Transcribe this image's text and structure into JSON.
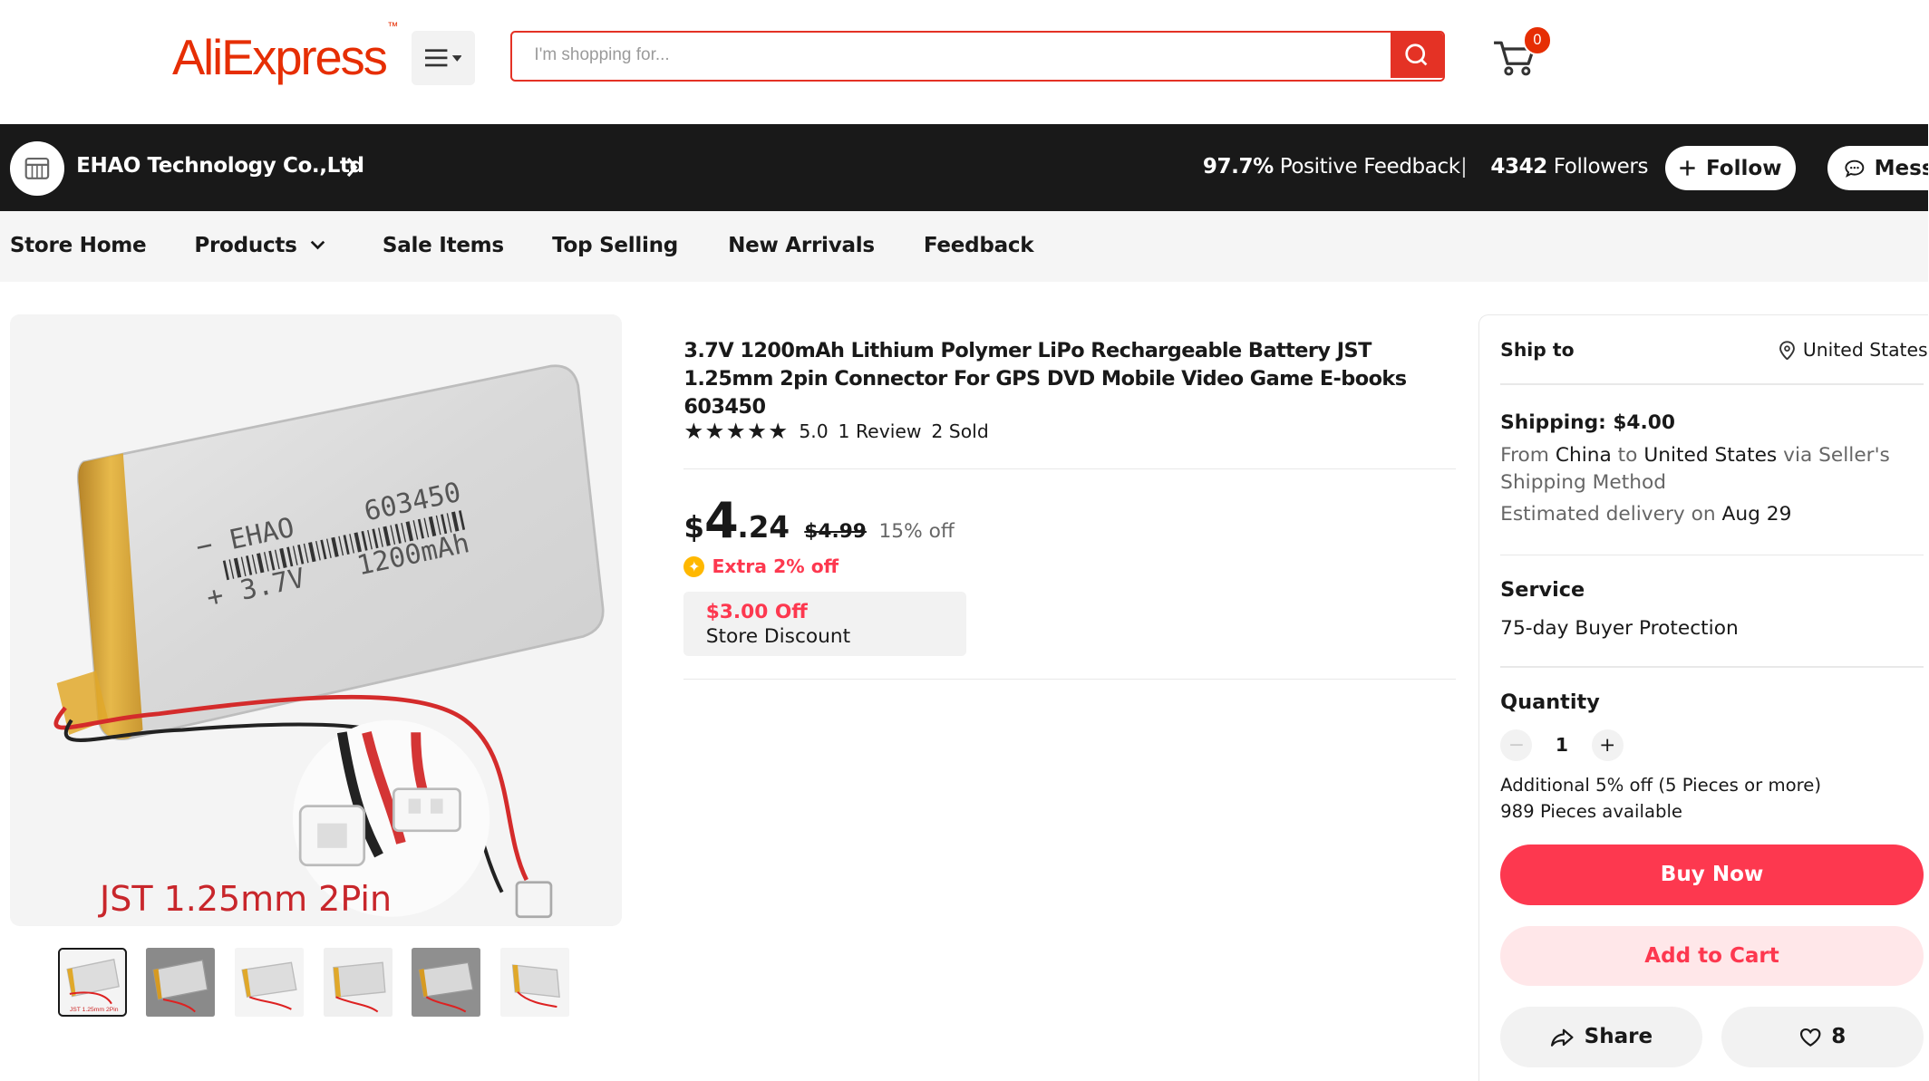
{
  "header": {
    "logo_text": "AliExpress",
    "logo_tm": "™",
    "search_placeholder": "I'm shopping for...",
    "cart_count": "0"
  },
  "store": {
    "name": "EHAO Technology Co.,Ltd",
    "feedback_value": "97.7%",
    "feedback_label": "Positive Feedback",
    "followers_value": "4342",
    "followers_label": "Followers",
    "follow_label": "Follow",
    "message_label": "Messa"
  },
  "nav": {
    "items": [
      "Store Home",
      "Products",
      "Sale Items",
      "Top Selling",
      "New Arrivals",
      "Feedback"
    ]
  },
  "gallery": {
    "image_caption": "JST 1.25mm 2Pin",
    "battery_brand": "EHAO",
    "battery_model": "603450",
    "battery_voltage": "3.7V",
    "battery_capacity": "1200mAh",
    "battery_minus": "−",
    "battery_plus": "+",
    "thumbnail_count": 6
  },
  "product": {
    "title": "3.7V 1200mAh Lithium Polymer LiPo Rechargeable Battery JST 1.25mm 2pin Connector For GPS DVD Mobile Video Game E-books 603450",
    "stars": "★★★★★",
    "rating": "5.0",
    "reviews": "1 Review",
    "sold": "2 Sold",
    "price_currency": "$",
    "price_int": "4",
    "price_dec": ".24",
    "price_original": "$4.99",
    "discount": "15% off",
    "extra_off": "Extra 2% off",
    "coupon_amount": "$3.00 Off",
    "coupon_label": "Store Discount"
  },
  "panel": {
    "ship_to_label": "Ship to",
    "ship_to_country": "United States",
    "shipping_cost": "Shipping: $4.00",
    "ship_from_pre": "From",
    "ship_from": "China",
    "ship_to_word": "to",
    "ship_dest": "United States",
    "ship_via": "via Seller's Shipping Method",
    "est_pre": "Estimated delivery on",
    "est_date": "Aug 29",
    "service_label": "Service",
    "service_value": "75-day Buyer Protection",
    "quantity_label": "Quantity",
    "quantity_minus": "−",
    "quantity_value": "1",
    "quantity_plus": "+",
    "additional_discount": "Additional 5% off (5 Pieces or more)",
    "available": "989 Pieces available",
    "buy_now": "Buy Now",
    "add_to_cart": "Add to Cart",
    "share": "Share",
    "wish_count": "8"
  },
  "colors": {
    "brand": "#e62e04",
    "search_border": "#e43225",
    "accent_red": "#fd384f",
    "store_bar": "#191919"
  }
}
